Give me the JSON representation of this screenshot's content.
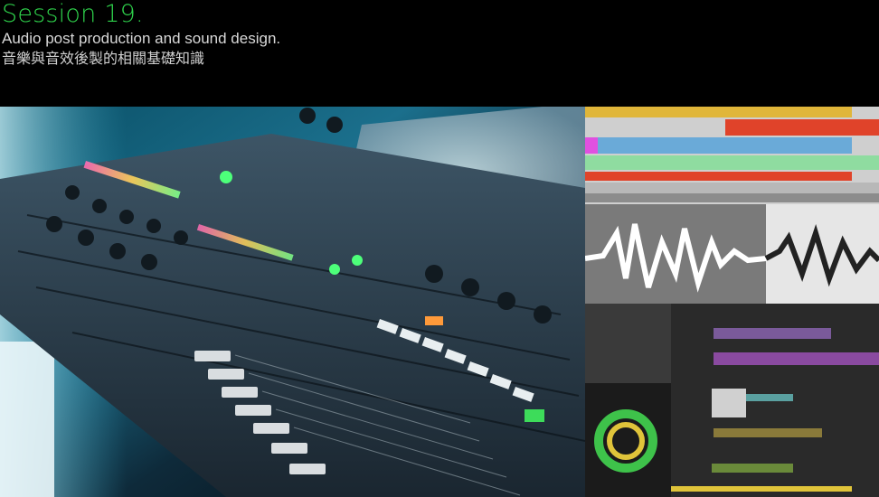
{
  "header": {
    "title": "Session 19.",
    "subtitle": "Audio post production and sound design.",
    "subtitle_zh": "音樂與音效後製的相關基礎知識"
  },
  "images": {
    "main_photo": "mixing-console-photo",
    "daw_top": "daw-arrangement-screenshot",
    "waveform": "waveform-editor-screenshot",
    "daw_bottom": "daw-multitrack-with-loudness-meter"
  },
  "colors": {
    "title_green": "#2fd44c",
    "background": "#000000"
  }
}
